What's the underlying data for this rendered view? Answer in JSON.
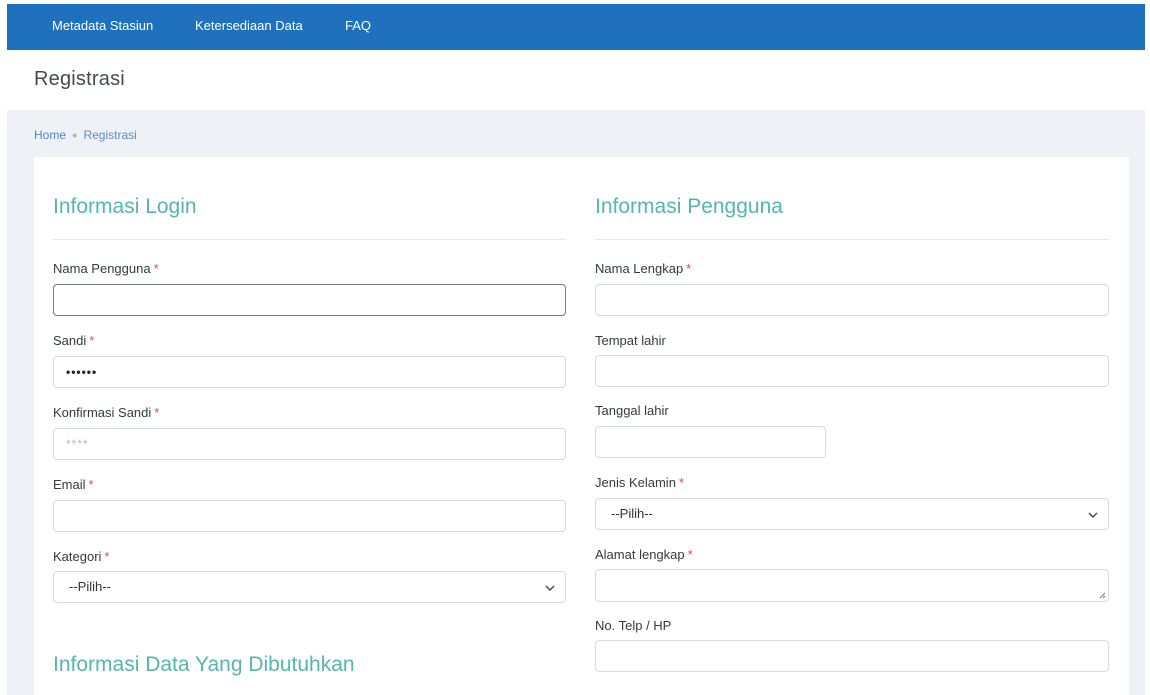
{
  "nav": {
    "items": [
      "Metadata Stasiun",
      "Ketersediaan Data",
      "FAQ"
    ]
  },
  "page": {
    "title": "Registrasi"
  },
  "breadcrumb": {
    "home": "Home",
    "current": "Registrasi"
  },
  "login_section": {
    "heading": "Informasi Login",
    "username_label": "Nama Pengguna",
    "password_label": "Sandi",
    "password_value": "••••••",
    "confirm_label": "Konfirmasi Sandi",
    "confirm_placeholder": "****",
    "email_label": "Email",
    "category_label": "Kategori",
    "category_value": "--Pilih--"
  },
  "user_section": {
    "heading": "Informasi Pengguna",
    "fullname_label": "Nama Lengkap",
    "birthplace_label": "Tempat lahir",
    "birthdate_label": "Tanggal lahir",
    "gender_label": "Jenis Kelamin",
    "gender_value": "--Pilih--",
    "address_label": "Alamat lengkap",
    "phone_label": "No. Telp / HP"
  },
  "data_section": {
    "heading": "Informasi Data Yang Dibutuhkan"
  },
  "required_mark": "*",
  "colors": {
    "navbar": "#1f71be",
    "heading_teal": "#56b5ad",
    "required_red": "#e0474c",
    "page_bg": "#eef1f6"
  }
}
